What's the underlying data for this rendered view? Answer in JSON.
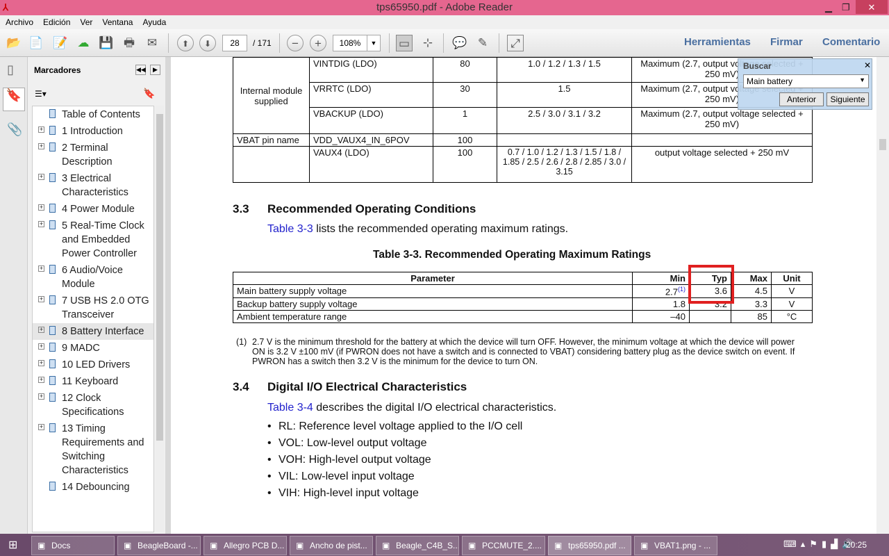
{
  "window": {
    "title": "tps65950.pdf - Adobe Reader"
  },
  "menu": [
    "Archivo",
    "Edición",
    "Ver",
    "Ventana",
    "Ayuda"
  ],
  "toolbar": {
    "page": "28",
    "total": "/ 171",
    "zoom": "108%",
    "tools": "Herramientas",
    "sign": "Firmar",
    "comment": "Comentario"
  },
  "sidebar": {
    "title": "Marcadores",
    "items": [
      {
        "label": "Table of Contents",
        "expand": false
      },
      {
        "label": "1   Introduction",
        "expand": true
      },
      {
        "label": "2  Terminal Description",
        "expand": true
      },
      {
        "label": "3  Electrical Characteristics",
        "expand": true
      },
      {
        "label": "4  Power Module",
        "expand": true
      },
      {
        "label": "5  Real-Time Clock and Embedded Power Controller",
        "expand": true
      },
      {
        "label": "6  Audio/Voice Module",
        "expand": true
      },
      {
        "label": "7  USB HS 2.0 OTG Transceiver",
        "expand": true
      },
      {
        "label": "8  Battery Interface",
        "expand": true,
        "selected": true
      },
      {
        "label": "9  MADC",
        "expand": true
      },
      {
        "label": "10  LED Drivers",
        "expand": true
      },
      {
        "label": "11  Keyboard",
        "expand": true
      },
      {
        "label": "12  Clock Specifications",
        "expand": true
      },
      {
        "label": "13  Timing Requirements and Switching Characteristics",
        "expand": true
      },
      {
        "label": "14  Debouncing",
        "expand": false
      }
    ]
  },
  "search": {
    "title": "Buscar",
    "value": "Main battery",
    "prev": "Anterior",
    "next": "Siguiente"
  },
  "doc": {
    "top_table": {
      "group1": "Internal module supplied",
      "rows": [
        [
          "VINTDIG (LDO)",
          "80",
          "1.0 / 1.2 / 1.3 / 1.5",
          "Maximum (2.7, output voltage selected + 250 mV)"
        ],
        [
          "VRRTC (LDO)",
          "30",
          "1.5",
          "Maximum (2.7, output voltage selected + 250 mV)"
        ],
        [
          "VBACKUP (LDO)",
          "1",
          "2.5 / 3.0 / 3.1 / 3.2",
          "Maximum (2.7, output voltage selected + 250 mV)"
        ]
      ],
      "vbat_label": "VBAT pin name",
      "vbat_row": [
        "VDD_VAUX4_IN_6POV",
        "100",
        "",
        ""
      ],
      "vaux4_row": [
        "VAUX4 (LDO)",
        "100",
        "0.7 / 1.0 / 1.2 / 1.3 / 1.5 / 1.8 / 1.85 / 2.5 / 2.6 / 2.8 / 2.85 / 3.0 / 3.15",
        "output voltage selected + 250 mV"
      ]
    },
    "s33": {
      "num": "3.3",
      "title": "Recommended Operating Conditions",
      "link": "Table 3-3",
      "text": " lists the recommended operating maximum ratings.",
      "caption": "Table 3-3. Recommended Operating Maximum Ratings"
    },
    "rt": {
      "headers": [
        "Parameter",
        "Min",
        "Typ",
        "Max",
        "Unit"
      ],
      "rows": [
        [
          "Main battery supply voltage",
          "2.7",
          "3.6",
          "4.5",
          "V"
        ],
        [
          "Backup battery supply voltage",
          "1.8",
          "3.2",
          "3.3",
          "V"
        ],
        [
          "Ambient temperature range",
          "–40",
          "",
          "85",
          "°C"
        ]
      ],
      "sup": "(1)",
      "note_num": "(1)",
      "note": "2.7 V is the minimum threshold for the battery at which the device will turn OFF. However, the minimum voltage at which the device will power ON is 3.2 V ±100 mV (if PWRON does not have a switch and is connected to VBAT) considering battery plug as the device switch on event. If PWRON has a switch then 3.2 V is the minimum for the device to turn ON.",
      "highlight_color": "#e02020"
    },
    "s34": {
      "num": "3.4",
      "title": "Digital I/O Electrical Characteristics",
      "link": "Table 3-4",
      "text": " describes the digital I/O electrical characteristics.",
      "bullets": [
        "RL: Reference level voltage applied to the I/O cell",
        "VOL: Low-level output voltage",
        "VOH: High-level output voltage",
        "VIL: Low-level input voltage",
        "VIH: High-level input voltage"
      ]
    }
  },
  "taskbar": {
    "items": [
      "Docs",
      "BeagleBoard -...",
      "Allegro PCB D...",
      "Ancho de pist...",
      "Beagle_C4B_S...",
      "PCCMUTE_2....",
      "tps65950.pdf ...",
      "VBAT1.png - ..."
    ],
    "active": 6,
    "time": "20:25"
  }
}
